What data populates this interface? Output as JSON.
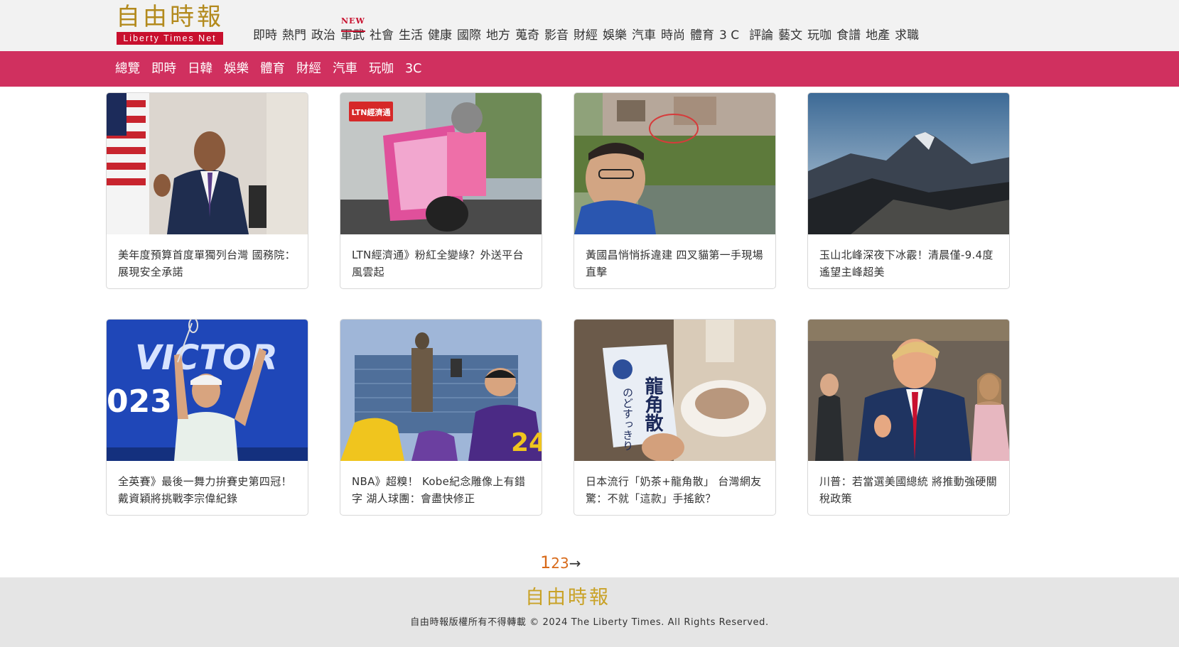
{
  "header": {
    "logo_cn": "自由時報",
    "logo_en": "Liberty Times Net",
    "new_badge": "NEW",
    "nav": [
      "即時",
      "熱門",
      "政治",
      "軍武",
      "社會",
      "生活",
      "健康",
      "國際",
      "地方",
      "蒐奇",
      "影音",
      "財經",
      "娛樂",
      "汽車",
      "時尚",
      "體育",
      "3 C",
      "評論",
      "藝文",
      "玩咖",
      "食譜",
      "地產",
      "求職"
    ]
  },
  "subnav": [
    "總覽",
    "即時",
    "日韓",
    "娛樂",
    "體育",
    "財經",
    "汽車",
    "玩咖",
    "3C"
  ],
  "cards": [
    {
      "title": "美年度預算首度單獨列台灣 國務院：展現安全承諾"
    },
    {
      "title": "LTN經濟通》粉紅全變綠？外送平台風雲起"
    },
    {
      "title": "黃國昌悄悄拆違建 四叉貓第一手現場直擊"
    },
    {
      "title": "玉山北峰深夜下冰霰！清晨僅-9.4度 遙望主峰超美"
    },
    {
      "title": "全英賽》最後一舞力拚賽史第四冠！ 戴資穎將挑戰李宗偉紀錄"
    },
    {
      "title": "NBA》超糗！ Kobe紀念雕像上有錯字 湖人球團：會盡快修正"
    },
    {
      "title": "日本流行「奶茶+龍角散」 台灣網友驚：不就「這款」手搖飲？"
    },
    {
      "title": "川普：若當選美國總統 將推動強硬關稅政策"
    }
  ],
  "image_text": {
    "ltn_badge": "LTN經濟通",
    "victor": "VICTOR",
    "year": "023",
    "jersey": "24",
    "package": "龍角散",
    "package_sub": "のどすっきり"
  },
  "pagination": {
    "current": "1",
    "pages": [
      "2",
      "3"
    ],
    "next": "→"
  },
  "footer": {
    "logo": "自由時報",
    "copyright": "自由時報版權所有不得轉載 © 2024 The Liberty Times. All Rights Reserved."
  },
  "colors": {
    "accent_pink": "#d0305f",
    "brand_red": "#c8102e",
    "logo_gold": "#b38a1d",
    "pager_orange": "#d86a1a"
  }
}
